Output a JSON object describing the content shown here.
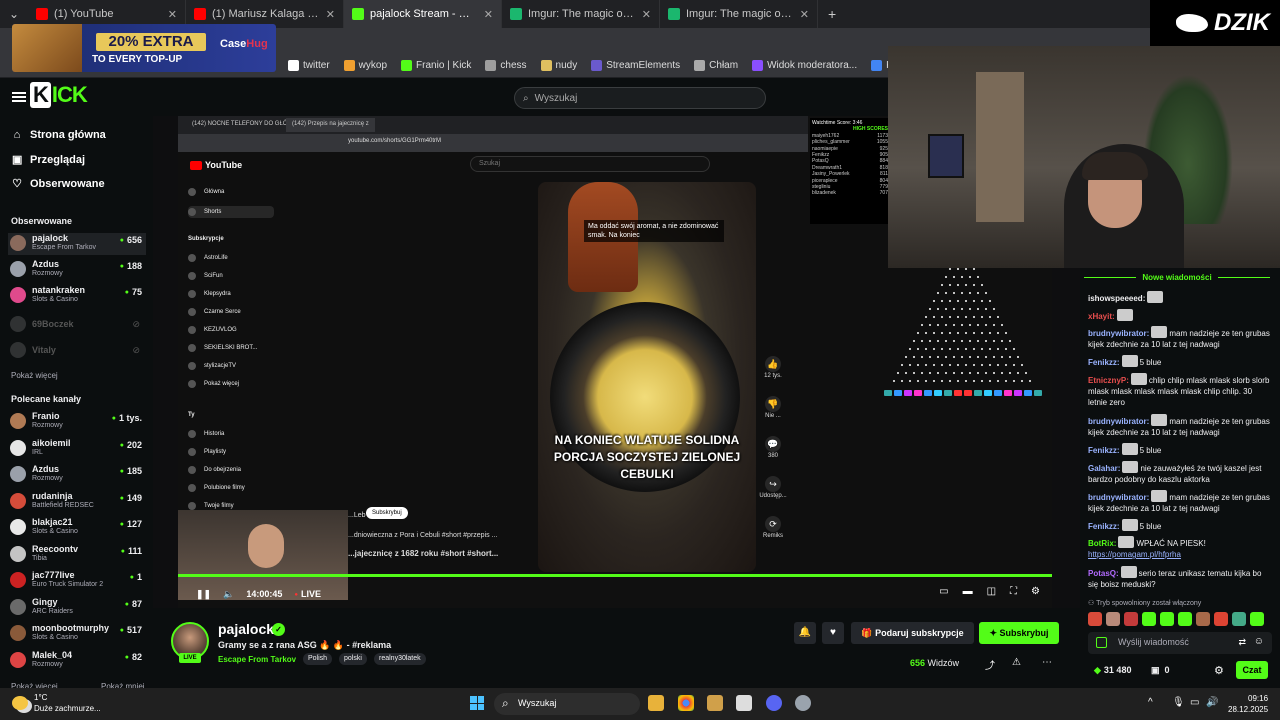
{
  "browser": {
    "tabs": [
      {
        "title": "(1) YouTube",
        "color": "#ff0000",
        "active": false
      },
      {
        "title": "(1) Mariusz Kalaga - Jedna z gw",
        "color": "#ff0000",
        "active": false
      },
      {
        "title": "pajalock Stream - Watch Live",
        "color": "#53fc18",
        "active": true
      },
      {
        "title": "Imgur: The magic of the Internet",
        "color": "#1bb76e",
        "active": false
      },
      {
        "title": "Imgur: The magic of the Internet",
        "color": "#1bb76e",
        "active": false
      }
    ],
    "bookmarks": [
      "twitter",
      "wykop",
      "Franio | Kick",
      "chess",
      "nudy",
      "StreamElements",
      "Chłam",
      "Widok moderatora...",
      "Kalendarz Google -..."
    ]
  },
  "ad": {
    "headline": "20% EXTRA",
    "subline": "TO EVERY TOP-UP",
    "brand_a": "Case",
    "brand_b": "Hug"
  },
  "kick": {
    "logo": "KICK",
    "search_placeholder": "Wyszukaj"
  },
  "sidebar": {
    "nav": [
      {
        "label": "Strona główna",
        "icon": "home-icon"
      },
      {
        "label": "Przeglądaj",
        "icon": "browse-icon"
      },
      {
        "label": "Obserwowane",
        "icon": "heart-icon"
      }
    ],
    "followed_header": "Obserwowane",
    "followed": [
      {
        "name": "pajalock",
        "category": "Escape From Tarkov",
        "viewers": "656",
        "color": "#8a6a5c"
      },
      {
        "name": "Azdus",
        "category": "Rozmowy",
        "viewers": "188",
        "color": "#9aa0aa"
      },
      {
        "name": "natankraken",
        "category": "Slots & Casino",
        "viewers": "75",
        "color": "#e04a8c"
      }
    ],
    "offline": [
      {
        "name": "69Boczek",
        "color": "#888"
      },
      {
        "name": "Vitaly",
        "color": "#888"
      }
    ],
    "show_more": "Pokaż więcej",
    "recommended_header": "Polecane kanały",
    "recommended": [
      {
        "name": "Franio",
        "category": "Rozmowy",
        "viewers": "1 tys.",
        "color": "#b07a54"
      },
      {
        "name": "aikoiemil",
        "category": "IRL",
        "viewers": "202",
        "color": "#e6e6e6"
      },
      {
        "name": "Azdus",
        "category": "Rozmowy",
        "viewers": "185",
        "color": "#9aa0aa"
      },
      {
        "name": "rudaninja",
        "category": "Battlefield REDSEC",
        "viewers": "149",
        "color": "#d44c3a"
      },
      {
        "name": "blakjac21",
        "category": "Slots & Casino",
        "viewers": "127",
        "color": "#e8e8e8"
      },
      {
        "name": "Reecoontv",
        "category": "Tibia",
        "viewers": "111",
        "color": "#c4c4c4"
      },
      {
        "name": "jac777live",
        "category": "Euro Truck Simulator 2",
        "viewers": "1",
        "color": "#c22"
      },
      {
        "name": "Gingy",
        "category": "ARC Raiders",
        "viewers": "87",
        "color": "#6a6a6a"
      },
      {
        "name": "moonbootmurphy",
        "category": "Slots & Casino",
        "viewers": "517",
        "color": "#8a5a3a"
      },
      {
        "name": "Malek_04",
        "category": "Rozmowy",
        "viewers": "82",
        "color": "#d44"
      }
    ],
    "show_more2": "Pokaż więcej",
    "show_less": "Pokaż mniej"
  },
  "stream": {
    "inner_tabs": [
      "(142) NOCNE TELEFONY DO GŁÓW",
      "(142) Przepis na jajecznicę z"
    ],
    "inner_url": "youtube.com/shorts/GG1Prm40trM",
    "yt_logo": "YouTube",
    "yt_search": "Szukaj",
    "yt_nav": [
      "Główna",
      "Shorts"
    ],
    "subs_header": "Subskrypcje",
    "subs": [
      "AstroLife",
      "SciFun",
      "Klepsydra",
      "Czarne Serce",
      "KEZUVLOG",
      "SEKIELSKI BROT...",
      "stylizacjeTV",
      "Pokaż więcej"
    ],
    "you_header": "Ty",
    "you_items": [
      "Historia",
      "Playlisty",
      "Do obejrzenia",
      "Polubione filmy",
      "Twoje filmy"
    ],
    "caption_top": "Ma oddać swój aromat, a nie zdominować smak. Na koniec",
    "caption_big": "NA KONIEC WLATUJE SOLIDNA PORCJA SOCZYSTEJ ZIELONEJ CEBULKI",
    "actions": [
      {
        "icon": "like-icon",
        "label": "12 tys."
      },
      {
        "icon": "dislike-icon",
        "label": "Nie ..."
      },
      {
        "icon": "comment-icon",
        "label": "380"
      },
      {
        "icon": "share-icon",
        "label": "Udostęp..."
      },
      {
        "icon": "remix-icon",
        "label": "Remiks"
      }
    ],
    "short_channel": "...Leb",
    "short_sub": "Subskrybuj",
    "short_desc1": "...dniowieczna z Pora i Cebuli #short #przepis ...",
    "short_desc2": "...jajecznicę z 1682 roku #short #short...",
    "scoreboard_title": "Watchtime Score: 3:46",
    "scoreboard_hs": "HIGH SCORES",
    "scores": [
      [
        "maiyeh1762",
        "1173"
      ],
      [
        "pliches_glammer",
        "1055"
      ],
      [
        "naomiaepie",
        "925"
      ],
      [
        "Fenikzz",
        "905"
      ],
      [
        "PotasQ",
        "884"
      ],
      [
        "Dreamwrath1",
        "818"
      ],
      [
        "Jasiny_Powerlek",
        "811"
      ],
      [
        "piceraplece",
        "804"
      ],
      [
        "stegliniu",
        "779"
      ],
      [
        "blizadenek",
        "707"
      ]
    ],
    "time": "14:00:45",
    "live": "LIVE",
    "progress": 100
  },
  "webcam_brand": "DZIK",
  "chat": {
    "header": "Nowe wiadomości",
    "messages": [
      {
        "user": "ishowspeeeed:",
        "color": "#efeff1",
        "text": ""
      },
      {
        "user": "xHayit:",
        "color": "#e84e4e",
        "text": ""
      },
      {
        "user": "brudnywibrator:",
        "color": "#9ab3ff",
        "text": "mam nadzieje ze ten grubas kijek zdechnie za 10 lat z tej nadwagi"
      },
      {
        "user": "Fenikzz:",
        "color": "#9ab3ff",
        "text": "5 blue"
      },
      {
        "user": "EtnicznyP:",
        "color": "#e84e4e",
        "text": "chlip chlip mlask mlask slorb slorb mlask mlask mlask mlask mlask chlip chlip. 30 letnie zero"
      },
      {
        "user": "brudnywibrator:",
        "color": "#9ab3ff",
        "text": "mam nadzieje ze ten grubas kijek zdechnie za 10 lat z tej nadwagi"
      },
      {
        "user": "Fenikzz:",
        "color": "#9ab3ff",
        "text": "5 blue"
      },
      {
        "user": "Galahar:",
        "color": "#9ab3ff",
        "text": "nie zauważyłeś że twój kaszel jest bardzo podobny do kaszlu aktorka"
      },
      {
        "user": "brudnywibrator:",
        "color": "#9ab3ff",
        "text": "mam nadzieje ze ten grubas kijek zdechnie za 10 lat z tej nadwagi"
      },
      {
        "user": "Fenikzz:",
        "color": "#9ab3ff",
        "text": "5 blue"
      },
      {
        "user": "BotRix:",
        "color": "#53fc18",
        "text": "WPŁAĆ NA PIESK!",
        "link": "https://pomagam.pl/hfprha"
      },
      {
        "user": "PotasQ:",
        "color": "#b36bff",
        "text": "serio teraz unikasz tematu kijka bo się boisz meduski?"
      }
    ],
    "slowmode": "Tryb spowolniony został włączony",
    "input_placeholder": "Wyślij wiadomość",
    "points": "31 480",
    "gifts": "0",
    "send": "Czat"
  },
  "channel": {
    "name": "pajalock",
    "title": "Gramy se a z rana ASG 🔥 🔥 - #reklama",
    "category": "Escape From Tarkov",
    "tags": [
      "Polish",
      "polski",
      "realny30latek"
    ],
    "gift_button": "Podaruj subskrypcje",
    "subscribe_button": "Subskrybuj",
    "viewers": "656",
    "viewers_label": "Widzów",
    "live_badge": "LIVE"
  },
  "taskbar": {
    "temp": "1°C",
    "weather": "Duże zachmurze...",
    "search": "Wyszukaj",
    "time": "09:16",
    "date": "28.12.2025"
  }
}
